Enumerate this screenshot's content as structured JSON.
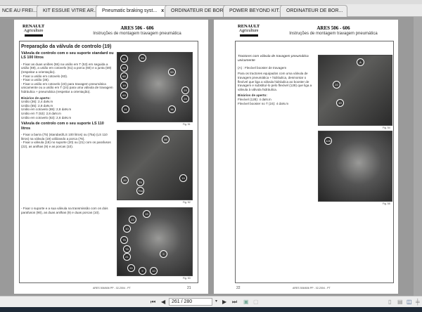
{
  "tabs": [
    {
      "label": "NCE AU FREI..."
    },
    {
      "label": "KIT ESSUIE VITRE AR..."
    },
    {
      "label": "Pneumatic braking syst...",
      "active": true,
      "close": "x"
    },
    {
      "label": "ORDINATEUR DE BOR..."
    },
    {
      "label": "POWER BEYOND KIT...."
    },
    {
      "label": "ORDINATEUR DE BOR..."
    }
  ],
  "logo": {
    "brand": "RENAULT",
    "sub": "Agriculture"
  },
  "header": {
    "title": "ARES 506 - 606",
    "subtitle": "Instruções de montagem travagem pneumática"
  },
  "left_page": {
    "heading": "Preparação da válvula de controlo (19)",
    "s1_title": "Válvula de controlo com o seu suporte standard ou LS 100 litros",
    "s1_steps": [
      "- Fixar as duas uniões (55) na união em T (53) em seguida a união (69), a união em cotovelo (61) a porca (60) e a junta (59) (respeitar a orientação).",
      "- Fixar a união em cotovelo (63).",
      "- Fixar a união (36).",
      "- Fixar a união em cotovelo (23) para travagem pneumática unicamente ou a união em T (24) para uma válvula de travagem hidráulica + pneumática (respeitar a orientação)."
    ],
    "torque_title": "Binários de aperto:",
    "torques": [
      "União (36): 2,4 daN.m",
      "União (55): 2,8 daN.m",
      "União em cotovelo (69): 2,8 daN.m",
      "União em T (53): 2,8 daN.m",
      "União em cotovelo (63): 2,6 daN.m"
    ],
    "s2_title": "Válvula de controlo com o seu suporte LS 110 litros",
    "s2_steps": [
      "- Fixar a barra (75) (standard/LS 100 litros) ou (75a) (LS 110 litros) na válvula (19) utilizando a porca (76).",
      "- Fixar a válvula (19) no suporte (20) ou (21) com os parafusos (22), as anilhas (9) e as porcas (10)."
    ],
    "s3_step": "- Fixar o suporte e a sua válvula na transmissão com os dois parafusos (90), as duas anilhas (9) e duas porcas (10).",
    "fig1": {
      "label": "Fig. 51",
      "callouts": [
        "61",
        "60",
        "55",
        "59",
        "53",
        "63",
        "19",
        "23",
        "24",
        "21",
        "36"
      ]
    },
    "fig2": {
      "label": "Fig. 52",
      "callouts": [
        "55",
        "20",
        "75",
        "75a",
        "19"
      ]
    },
    "fig3": {
      "label": "Fig. 53",
      "callouts": [
        "19",
        "22",
        "10",
        "76",
        "75",
        "21",
        "20",
        "9",
        "10",
        "9"
      ]
    },
    "footer": "ARES 506/606 PP - 02-2004 - PT",
    "page_number": "21"
  },
  "right_page": {
    "s_title": "Tractores com válvula de travagem pneumática unicamente",
    "a_line": "(A) : Flexível booster de travagem",
    "para": "Para os tractores equipados com uma válvula de travagem pneumática + hidráulica, desmontar o flexível que liga a válvula hidráulica ao booster de travagem e substituí-lo pelo flexível (128) que liga a válvula à válvula hidráulica.",
    "torque_title": "Binários de aperto:",
    "torques": [
      "Flexível (128): 4 daN.m",
      "Flexível booster no T (24): 4 daN.m"
    ],
    "fig1": {
      "label": "Fig. 54",
      "callouts": [
        "A",
        "22",
        "19"
      ]
    },
    "fig2": {
      "label": "Fig. 55",
      "callouts": [
        "128"
      ]
    },
    "footer": "ARES 506/606 PP - 02-2004 - PT",
    "page_number": "22"
  },
  "toolbar": {
    "page_value": "261 / 280",
    "first": "⏮",
    "prev": "◀",
    "next": "▶",
    "last": "⏭"
  }
}
